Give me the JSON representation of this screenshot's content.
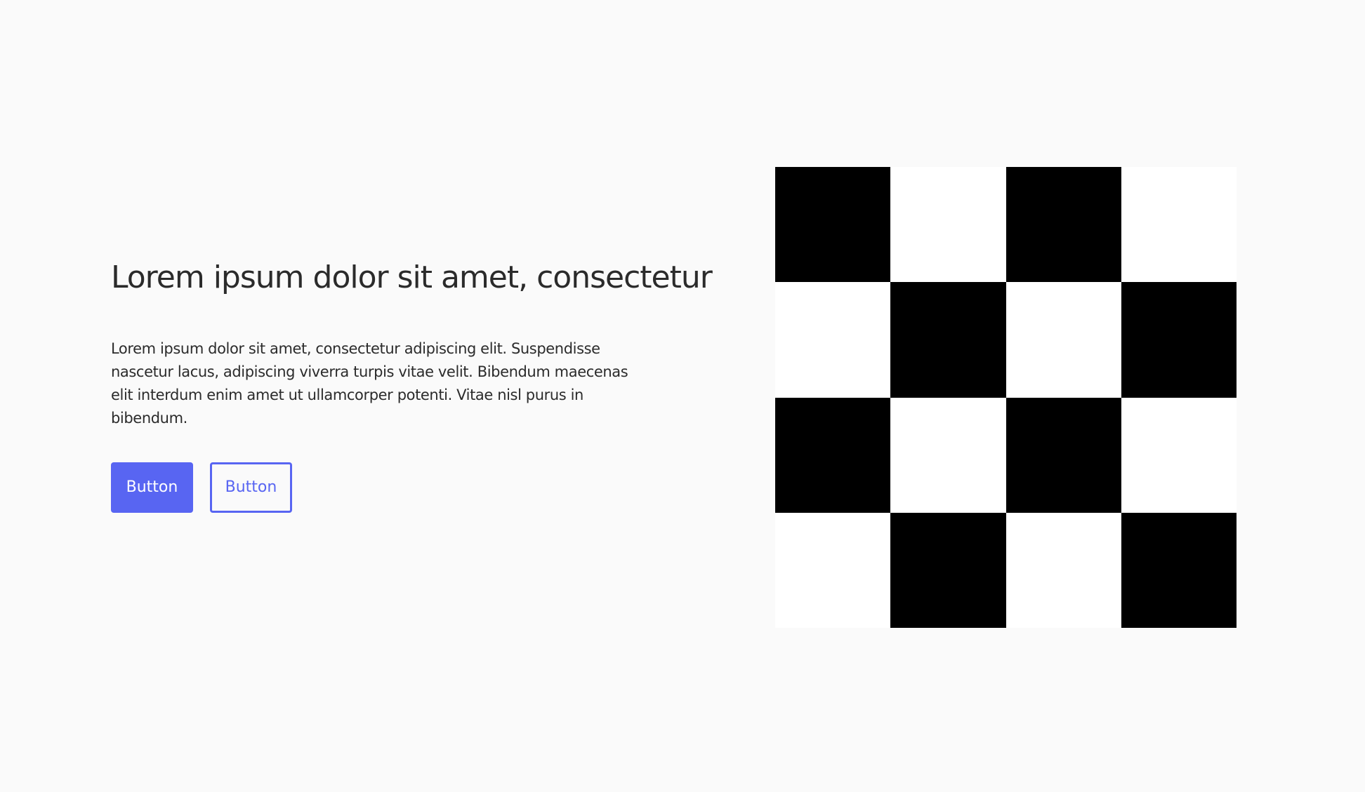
{
  "hero": {
    "title": "Lorem ipsum dolor sit amet, consectetur",
    "body": "Lorem ipsum dolor sit amet, consectetur adipiscing elit. Suspendisse nascetur lacus, adipiscing viverra turpis vitae velit. Bibendum maecenas elit interdum enim amet ut ullamcorper potenti. Vitae nisl purus in bibendum.",
    "primary_button": "Button",
    "secondary_button": "Button"
  },
  "image": {
    "type": "checkerboard",
    "rows": 4,
    "cols": 4,
    "dark_color": "#000000",
    "light_color": "#ffffff",
    "first_cell": "dark"
  },
  "colors": {
    "accent": "#5865f2",
    "background": "#fafafa",
    "text": "#2b2b2b"
  }
}
